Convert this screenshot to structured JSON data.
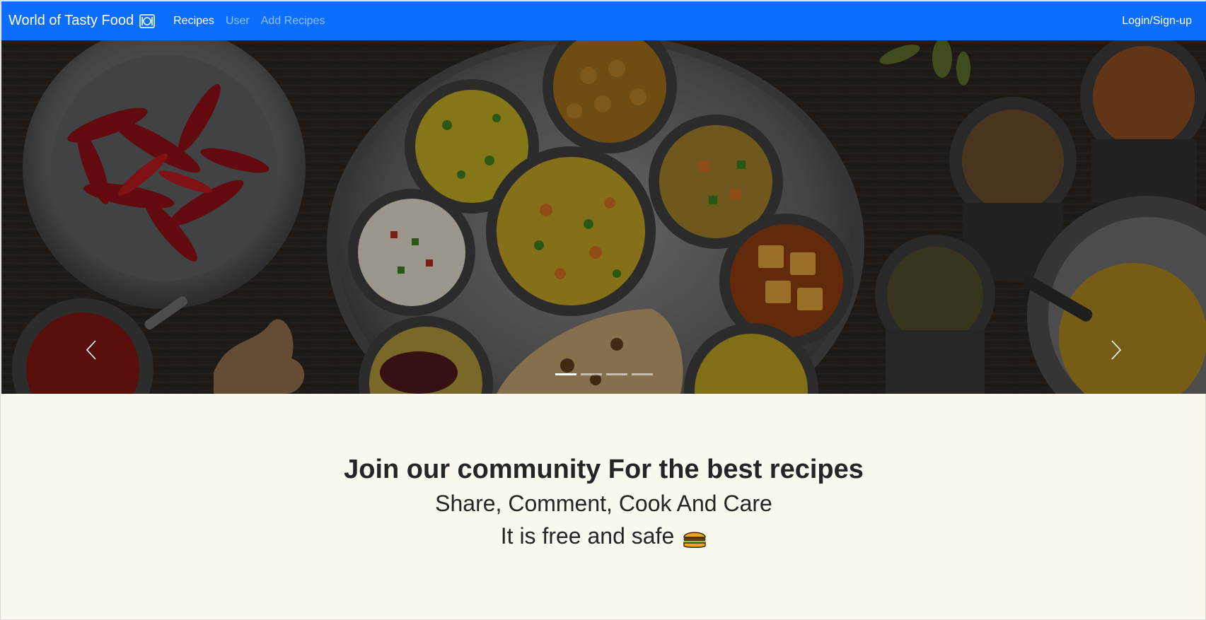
{
  "navbar": {
    "brand": "World of Tasty Food",
    "brand_icon": "plate-utensils-icon",
    "links": [
      {
        "label": "Recipes",
        "active": true
      },
      {
        "label": "User",
        "active": false
      },
      {
        "label": "Add Recipes",
        "active": false
      }
    ],
    "login_label": "Login/Sign-up",
    "bg_color": "#0d6efd"
  },
  "carousel": {
    "slide_count": 4,
    "active_index": 0,
    "prev_icon": "chevron-left-icon",
    "next_icon": "chevron-right-icon"
  },
  "community": {
    "heading": "Join our community For the best recipes",
    "subheading": "Share, Comment, Cook And Care",
    "tagline": "It is free and safe",
    "tagline_icon": "hamburger-icon"
  },
  "colors": {
    "page_bg": "#fbf8ef",
    "text": "#252525"
  }
}
